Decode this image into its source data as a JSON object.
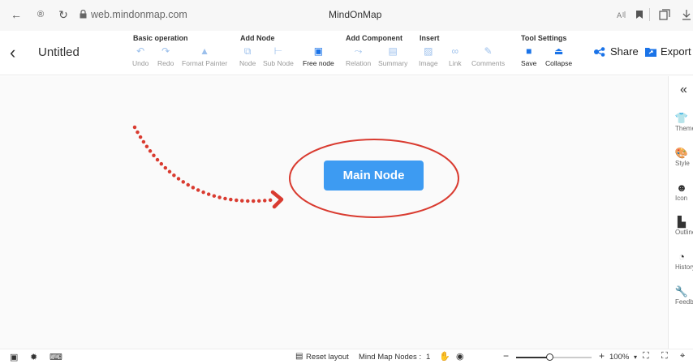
{
  "browser": {
    "url": "web.mindonmap.com",
    "tab_title": "MindOnMap",
    "back_glyph": "←",
    "reload_glyph": "↻",
    "ext_glyph": "®"
  },
  "toolbar": {
    "doc_title": "Untitled",
    "groups": {
      "basic": "Basic operation",
      "add_node": "Add Node",
      "add_component": "Add Component",
      "insert": "Insert",
      "tool_settings": "Tool Settings"
    },
    "tools": {
      "undo": "Undo",
      "redo": "Redo",
      "format_painter": "Format Painter",
      "node": "Node",
      "sub_node": "Sub Node",
      "free_node": "Free node",
      "relation": "Relation",
      "summary": "Summary",
      "image": "Image",
      "link": "Link",
      "comments": "Comments",
      "save": "Save",
      "collapse": "Collapse"
    },
    "share": "Share",
    "export": "Export"
  },
  "canvas": {
    "main_node": "Main Node",
    "annotation_color": "#d93b30"
  },
  "right_panel": {
    "collapse_glyph": "«",
    "items": [
      "Theme",
      "Style",
      "Icon",
      "Outline",
      "History",
      "Feedback"
    ]
  },
  "status": {
    "reset_layout": "Reset layout",
    "node_count_label": "Mind Map Nodes :",
    "node_count": "1",
    "zoom": "100%",
    "zoom_level": 0.44
  },
  "colors": {
    "accent": "#1a73e8",
    "node": "#3d9bf2"
  }
}
